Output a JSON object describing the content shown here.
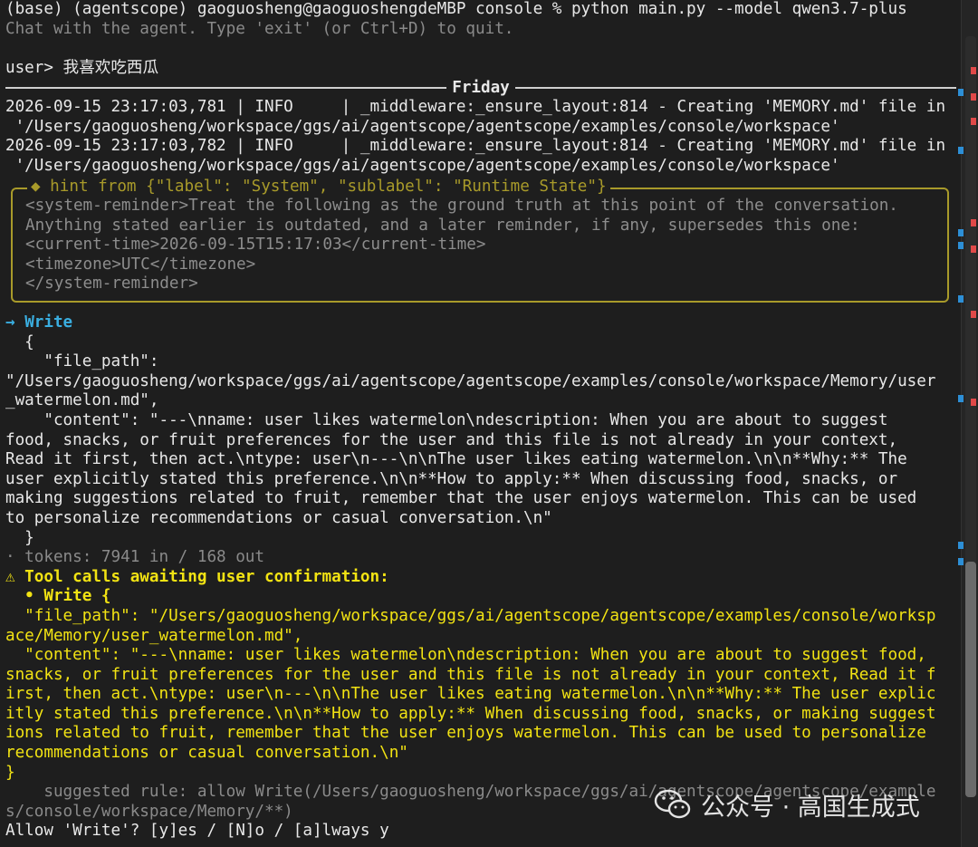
{
  "terminal": {
    "prompt_line": "(base) (agentscope) gaoguosheng@gaoguoshengdeMBP console % python main.py --model qwen3.7-plus",
    "intro_line": "Chat with the agent. Type 'exit' (or Ctrl+D) to quit.",
    "user_line": "user> 我喜欢吃西瓜",
    "agent_name": "Friday",
    "log_lines": [
      "2026-09-15 23:17:03,781 | INFO     | _middleware:_ensure_layout:814 - Creating 'MEMORY.md' file in",
      " '/Users/gaoguosheng/workspace/ggs/ai/agentscope/agentscope/examples/console/workspace'",
      "2026-09-15 23:17:03,782 | INFO     | _middleware:_ensure_layout:814 - Creating 'MEMORY.md' file in",
      " '/Users/gaoguosheng/workspace/ggs/ai/agentscope/agentscope/examples/console/workspace'"
    ],
    "hint": {
      "title": "◆ hint from {\"label\": \"System\", \"sublabel\": \"Runtime State\"}",
      "lines": [
        "<system-reminder>Treat the following as the ground truth at this point of the conversation.",
        "Anything stated earlier is outdated, and a later reminder, if any, supersedes this one:",
        "<current-time>2026-09-15T15:17:03</current-time>",
        "<timezone>UTC</timezone>",
        "</system-reminder>"
      ]
    },
    "tool_arrow": "→",
    "tool_name": "Write",
    "tool_lines": [
      "  {",
      "    \"file_path\":",
      "\"/Users/gaoguosheng/workspace/ggs/ai/agentscope/agentscope/examples/console/workspace/Memory/user",
      "_watermelon.md\",",
      "    \"content\": \"---\\nname: user likes watermelon\\ndescription: When you are about to suggest",
      "food, snacks, or fruit preferences for the user and this file is not already in your context,",
      "Read it first, then act.\\ntype: user\\n---\\n\\nThe user likes eating watermelon.\\n\\n**Why:** The",
      "user explicitly stated this preference.\\n\\n**How to apply:** When discussing food, snacks, or",
      "making suggestions related to fruit, remember that the user enjoys watermelon. This can be used",
      "to personalize recommendations or casual conversation.\\n\"",
      "  }"
    ],
    "tokens_line": "· tokens: 7941 in / 168 out",
    "confirm_header": "⚠ Tool calls awaiting user confirmation:",
    "confirm_item": "  • Write {",
    "confirm_lines": [
      "  \"file_path\": \"/Users/gaoguosheng/workspace/ggs/ai/agentscope/agentscope/examples/console/worksp",
      "ace/Memory/user_watermelon.md\",",
      "  \"content\": \"---\\nname: user likes watermelon\\ndescription: When you are about to suggest food,",
      "snacks, or fruit preferences for the user and this file is not already in your context, Read it f",
      "irst, then act.\\ntype: user\\n---\\n\\nThe user likes eating watermelon.\\n\\n**Why:** The user explic",
      "itly stated this preference.\\n\\n**How to apply:** When discussing food, snacks, or making suggest",
      "ions related to fruit, remember that the user enjoys watermelon. This can be used to personalize",
      "recommendations or casual conversation.\\n\"",
      "}"
    ],
    "suggested_lines": [
      "    suggested rule: allow Write(/Users/gaoguosheng/workspace/ggs/ai/agentscope/agentscope/example",
      "s/console/workspace/Memory/**)"
    ],
    "allow_prompt": "Allow 'Write'? [y]es / [N]o / [a]lways y"
  },
  "watermark": {
    "text": "公众号 · 高国生成式",
    "icon": "wechat-icon"
  },
  "colors": {
    "background": "#1e1e1e",
    "tool_name": "#3aaee0",
    "warning": "#f2e313",
    "hint_border": "#a89a2a",
    "marker_red": "#e04848",
    "marker_blue": "#2d8fd6"
  }
}
